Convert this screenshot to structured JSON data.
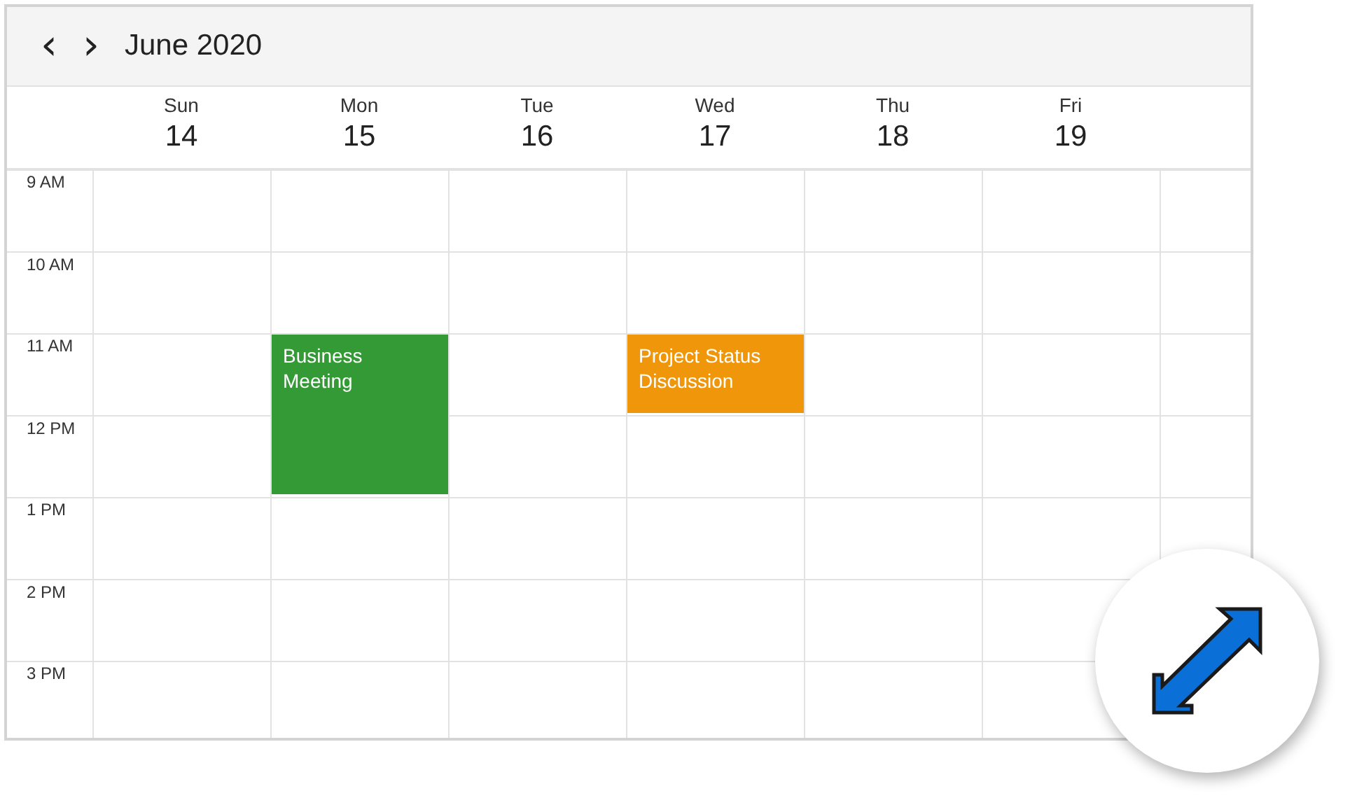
{
  "header": {
    "prev_button": "‹",
    "next_button": "›",
    "title": "June 2020"
  },
  "days": [
    {
      "name": "Sun",
      "date": "14"
    },
    {
      "name": "Mon",
      "date": "15"
    },
    {
      "name": "Tue",
      "date": "16"
    },
    {
      "name": "Wed",
      "date": "17"
    },
    {
      "name": "Thu",
      "date": "18"
    },
    {
      "name": "Fri",
      "date": "19"
    }
  ],
  "rows": [
    {
      "time": "9 AM",
      "slots": [
        {
          "kind": "empty"
        },
        {
          "kind": "empty"
        },
        {
          "kind": "empty"
        },
        {
          "kind": "empty"
        },
        {
          "kind": "empty"
        },
        {
          "kind": "empty"
        }
      ]
    },
    {
      "time": "10 AM",
      "slots": [
        {
          "kind": "empty"
        },
        {
          "kind": "empty"
        },
        {
          "kind": "empty"
        },
        {
          "kind": "empty"
        },
        {
          "kind": "empty"
        },
        {
          "kind": "empty"
        }
      ]
    },
    {
      "time": "11 AM",
      "slots": [
        {
          "kind": "empty"
        },
        {
          "kind": "event_start",
          "title": "Business Meeting",
          "color": "#339a35"
        },
        {
          "kind": "empty"
        },
        {
          "kind": "event",
          "title": "Project Status Discussion",
          "color": "#f0960a"
        },
        {
          "kind": "empty"
        },
        {
          "kind": "empty"
        }
      ]
    },
    {
      "time": "12 PM",
      "slots": [
        {
          "kind": "empty"
        },
        {
          "kind": "event_continued"
        },
        {
          "kind": "empty"
        },
        {
          "kind": "empty"
        },
        {
          "kind": "empty"
        },
        {
          "kind": "empty"
        }
      ]
    },
    {
      "time": "1 PM",
      "slots": [
        {
          "kind": "empty"
        },
        {
          "kind": "empty"
        },
        {
          "kind": "empty"
        },
        {
          "kind": "empty"
        },
        {
          "kind": "empty"
        },
        {
          "kind": "empty"
        }
      ]
    },
    {
      "time": "2 PM",
      "slots": [
        {
          "kind": "empty"
        },
        {
          "kind": "empty"
        },
        {
          "kind": "empty"
        },
        {
          "kind": "empty"
        },
        {
          "kind": "empty"
        },
        {
          "kind": "empty"
        }
      ]
    },
    {
      "time": "3 PM",
      "slots": [
        {
          "kind": "empty"
        },
        {
          "kind": "empty"
        },
        {
          "kind": "empty"
        },
        {
          "kind": "empty"
        },
        {
          "kind": "empty"
        },
        {
          "kind": "empty"
        }
      ]
    }
  ]
}
